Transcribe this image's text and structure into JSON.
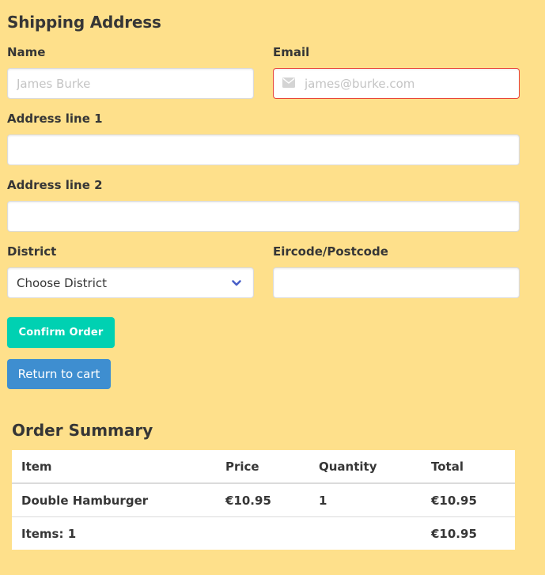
{
  "shipping": {
    "title": "Shipping Address",
    "name_label": "Name",
    "name_placeholder": "James Burke",
    "email_label": "Email",
    "email_placeholder": "james@burke.com",
    "address1_label": "Address line 1",
    "address2_label": "Address line 2",
    "district_label": "District",
    "district_selected": "Choose District",
    "postcode_label": "Eircode/Postcode",
    "email_icon": "envelope-icon",
    "district_icon": "chevron-down-icon"
  },
  "buttons": {
    "confirm": "Confirm Order",
    "return": "Return to cart"
  },
  "summary": {
    "title": "Order Summary",
    "headers": [
      "Item",
      "Price",
      "Quantity",
      "Total"
    ],
    "rows": [
      {
        "item": "Double Hamburger",
        "price": "€10.95",
        "quantity": "1",
        "total": "€10.95"
      }
    ],
    "footer_items": "Items: 1",
    "footer_total": "€10.95"
  },
  "colors": {
    "background": "#fee08b",
    "primary": "#00d1b2",
    "info": "#3e8ed0",
    "danger": "#e8453a",
    "chevron": "#485fc7"
  }
}
